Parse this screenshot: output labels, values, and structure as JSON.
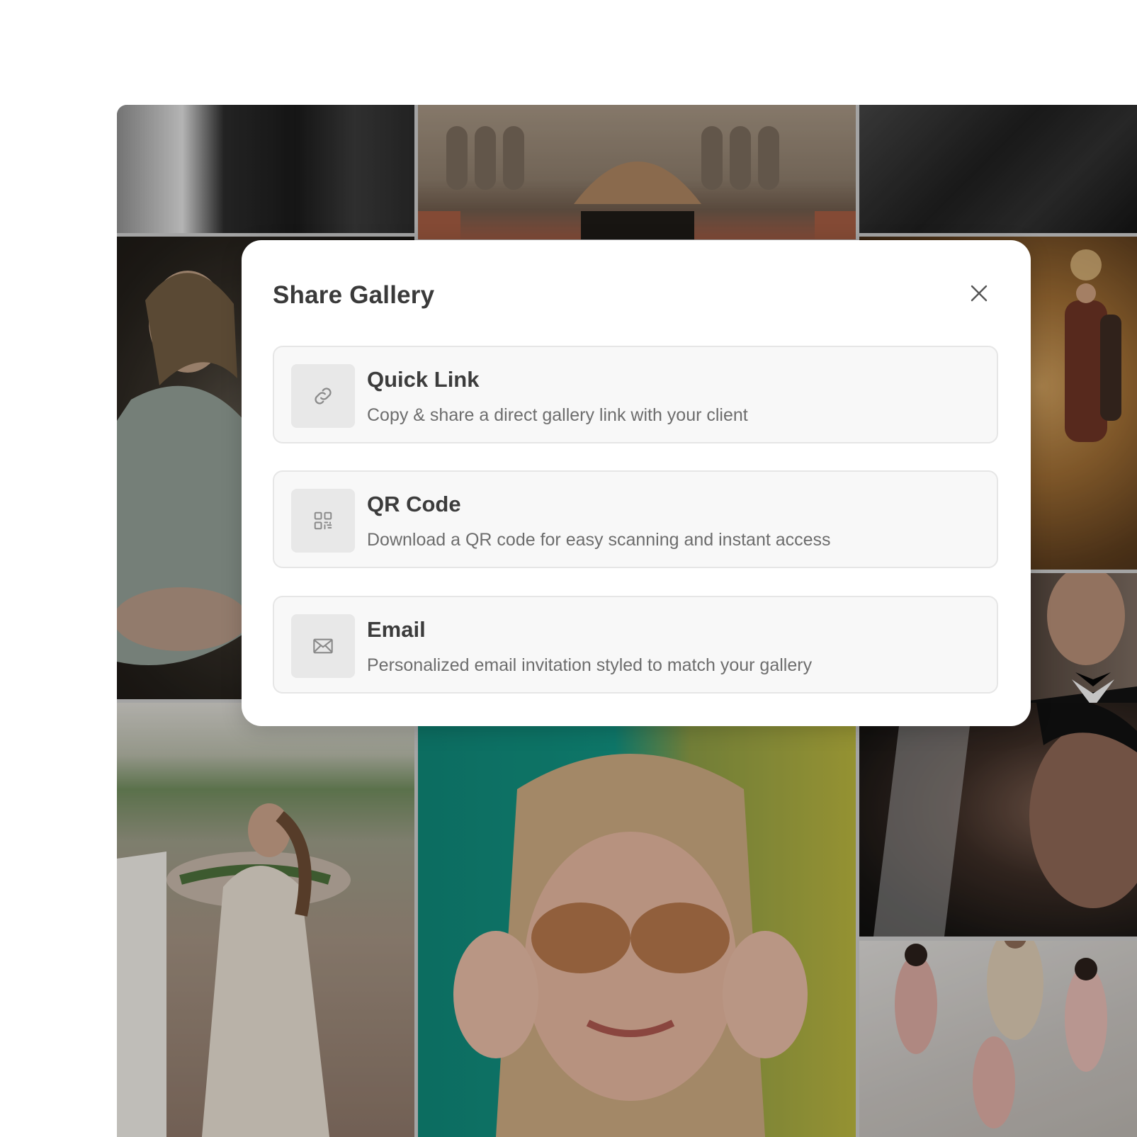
{
  "modal": {
    "title": "Share Gallery",
    "close_icon": "close-icon",
    "options": [
      {
        "icon": "link-icon",
        "title": "Quick Link",
        "description": "Copy & share a direct gallery link with your client"
      },
      {
        "icon": "qr-code-icon",
        "title": "QR Code",
        "description": "Download a QR code for easy scanning and instant access"
      },
      {
        "icon": "mail-icon",
        "title": "Email",
        "description": "Personalized email invitation styled to match your gallery"
      }
    ]
  },
  "colors": {
    "modal_background": "#ffffff",
    "option_background": "#f8f8f8",
    "option_border": "#e6e6e6",
    "icon_tile": "#e8e8e8",
    "title_text": "#3a3a3a",
    "description_text": "#6d6d6d"
  }
}
